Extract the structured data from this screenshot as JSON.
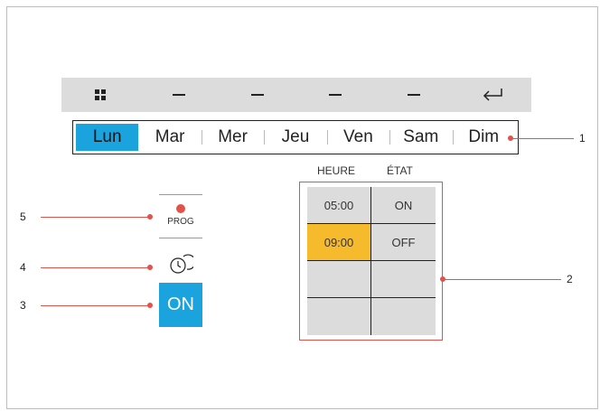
{
  "toolbar": {
    "grid_icon": "grid-icon",
    "back_icon": "return-arrow-icon",
    "placeholders": [
      "–",
      "–",
      "–",
      "–"
    ]
  },
  "days": [
    "Lun",
    "Mar",
    "Mer",
    "Jeu",
    "Ven",
    "Sam",
    "Dim"
  ],
  "active_day": "Lun",
  "schedule": {
    "headers": {
      "time": "HEURE",
      "state": "ÉTAT"
    },
    "rows": [
      {
        "time": "05:00",
        "state": "ON"
      },
      {
        "time": "09:00",
        "state": "OFF"
      },
      {
        "time": "",
        "state": ""
      },
      {
        "time": "",
        "state": ""
      }
    ],
    "highlighted": "09:00"
  },
  "left_panel": {
    "prog_label": "PROG",
    "timer_icon": "timer-clock-icon",
    "on_label": "ON"
  },
  "callouts": {
    "n1": "1",
    "n2": "2",
    "n3": "3",
    "n4": "4",
    "n5": "5"
  },
  "colors": {
    "accent_blue": "#1aa3dc",
    "highlight_yellow": "#f5bb2c",
    "callout_red": "#e2524a",
    "panel_grey": "#dcdcdc"
  }
}
